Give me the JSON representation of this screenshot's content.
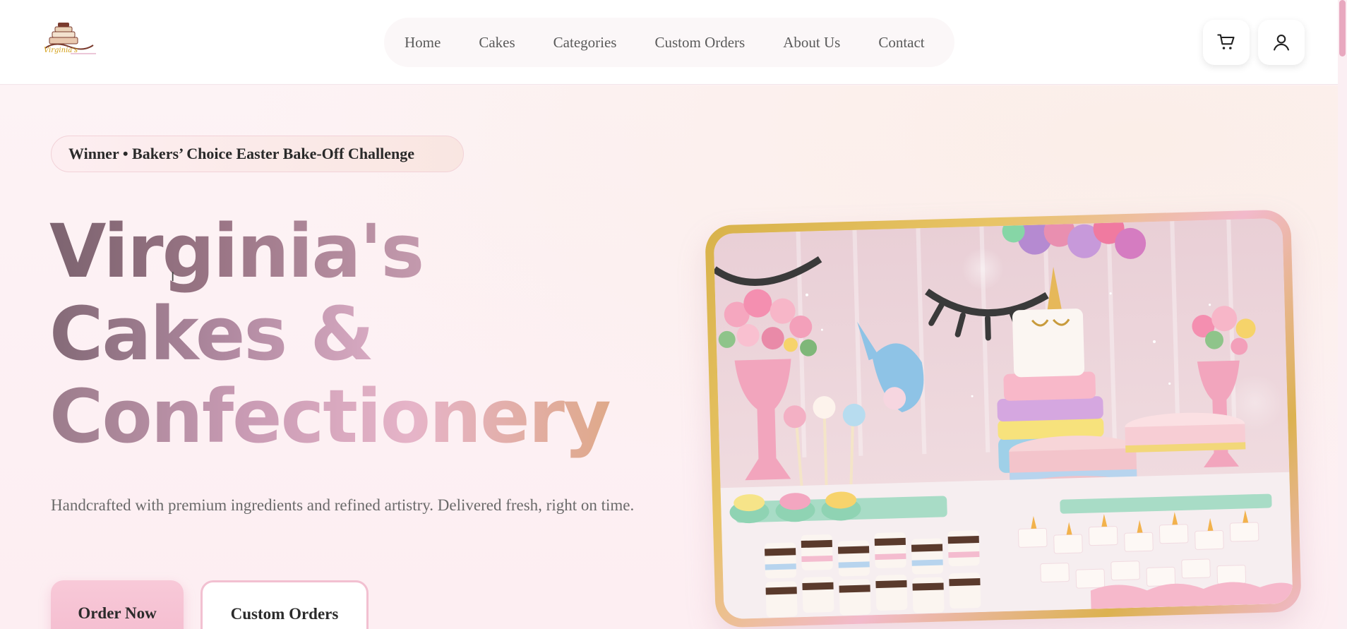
{
  "brand": {
    "logo_icon": "cake-logo-icon",
    "logo_text": "Virginia's"
  },
  "nav": {
    "items": [
      {
        "label": "Home"
      },
      {
        "label": "Cakes"
      },
      {
        "label": "Categories"
      },
      {
        "label": "Custom Orders"
      },
      {
        "label": "About Us"
      },
      {
        "label": "Contact"
      }
    ]
  },
  "header_actions": {
    "cart_icon": "cart-icon",
    "account_icon": "user-icon"
  },
  "hero": {
    "badge": "Winner • Bakers’ Choice Easter Bake-Off Challenge",
    "title_lines": [
      "Virginia's",
      "Cakes &",
      "Confectionery"
    ],
    "subtitle": "Handcrafted with premium ingredients and refined artistry. Delivered fresh, right on time.",
    "primary_cta": "Order Now",
    "secondary_cta": "Custom Orders"
  },
  "colors": {
    "accent_pink": "#f4bccf",
    "gold_frame": "#d8b24a",
    "title_mauve": "#7d6470",
    "background": "#fdf1f4"
  }
}
